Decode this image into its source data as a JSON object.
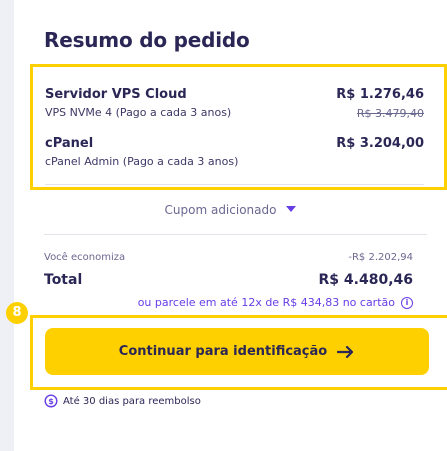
{
  "summary": {
    "title": "Resumo do pedido"
  },
  "items": [
    {
      "name": "Servidor VPS Cloud",
      "description": "VPS NVMe 4 (Pago a cada 3 anos)",
      "price": "R$ 1.276,46",
      "old_price": "R$ 3.479,40"
    },
    {
      "name": "cPanel",
      "description": "cPanel Admin (Pago a cada 3 anos)",
      "price": "R$ 3.204,00"
    }
  ],
  "coupon": {
    "label": "Cupom adicionado",
    "icon": "caret-down-icon"
  },
  "savings": {
    "label": "Você economiza",
    "value": "-R$ 2.202,94"
  },
  "total": {
    "label": "Total",
    "value": "R$ 4.480,46"
  },
  "installments": {
    "text": "ou parcele em até 12x de R$ 434,83 no cartão",
    "icon": "info-icon"
  },
  "step_badge": {
    "number": "8"
  },
  "continue_button": {
    "label": "Continuar para identificação",
    "icon": "arrow-right-icon"
  },
  "refund": {
    "text": "Até 30 dias para reembolso",
    "icon": "money-back-icon"
  },
  "colors": {
    "accent": "#673de6",
    "highlight": "#ffd000",
    "text": "#2a2655",
    "muted": "#6b6890"
  }
}
